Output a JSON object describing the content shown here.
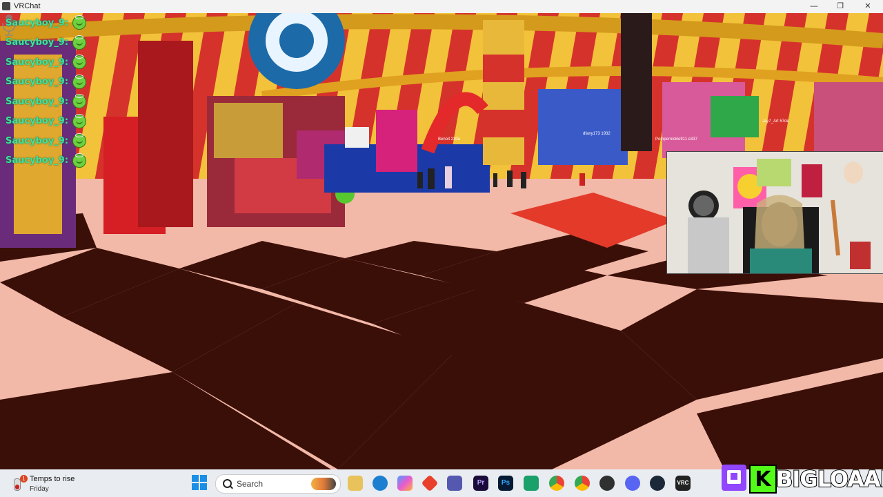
{
  "window": {
    "title": "VRChat"
  },
  "chat": {
    "messages": [
      {
        "user": "Saucyboy_9:"
      },
      {
        "user": "Saucyboy_9:"
      },
      {
        "user": "Saucyboy_9:"
      },
      {
        "user": "Saucyboy_9:"
      },
      {
        "user": "Saucyboy_9:"
      },
      {
        "user": "Saucyboy_9:"
      },
      {
        "user": "Saucyboy_9:"
      },
      {
        "user": "Saucyboy_9:"
      }
    ]
  },
  "nameplates": [
    "Pompernickle911 e337",
    "Jay7_Art 57de",
    "dfany173 1932",
    "Benoit 230a"
  ],
  "taskbar": {
    "weather": {
      "title": "Temps to rise",
      "subtitle": "Friday",
      "badge": "1"
    },
    "search_placeholder": "Search",
    "icons": [
      "start-icon",
      "file-explorer-icon",
      "edge-icon",
      "copilot-icon",
      "app-icon",
      "teams-icon",
      "premiere-icon",
      "photoshop-icon",
      "app2-icon",
      "chrome-icon",
      "chrome2-icon",
      "obs-icon",
      "discord-icon",
      "steam-icon",
      "vrchat-icon"
    ],
    "premiere_label": "Pr",
    "photoshop_label": "Ps",
    "vrc_label": "VRC"
  },
  "brand": {
    "name": "BIGLOAAF",
    "kick_letter": "K"
  },
  "colors": {
    "chat_name": "#3fe0a0",
    "taskbar_bg": "#e9ecf0",
    "twitch": "#9146ff",
    "kick": "#53fc18"
  }
}
